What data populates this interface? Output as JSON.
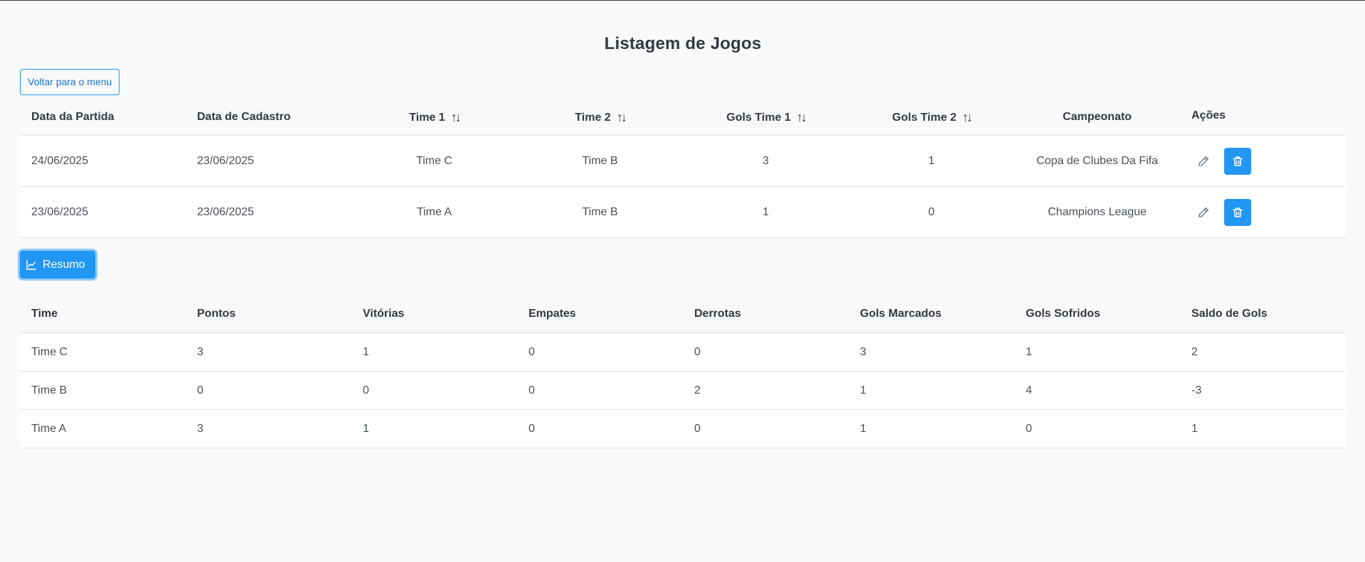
{
  "page_title": "Listagem de Jogos",
  "back_button_label": "Voltar para o menu",
  "games_table": {
    "headers": {
      "data_partida": "Data da Partida",
      "data_cadastro": "Data de Cadastro",
      "time1": "Time 1",
      "time2": "Time 2",
      "gols_time1": "Gols Time 1",
      "gols_time2": "Gols Time 2",
      "campeonato": "Campeonato",
      "acoes": "Ações"
    },
    "sort_icon": "sort-arrows-icon",
    "rows": [
      {
        "data_partida": "24/06/2025",
        "data_cadastro": "23/06/2025",
        "time1": "Time C",
        "time2": "Time B",
        "gols_time1": "3",
        "gols_time2": "1",
        "campeonato": "Copa de Clubes Da Fifa"
      },
      {
        "data_partida": "23/06/2025",
        "data_cadastro": "23/06/2025",
        "time1": "Time A",
        "time2": "Time B",
        "gols_time1": "1",
        "gols_time2": "0",
        "campeonato": "Champions League"
      }
    ],
    "row_actions": {
      "edit_icon": "pencil-icon",
      "delete_icon": "trash-icon"
    }
  },
  "resumo_button_label": "Resumo",
  "resumo_icon": "chart-line-icon",
  "summary_table": {
    "headers": {
      "time": "Time",
      "pontos": "Pontos",
      "vitorias": "Vitórias",
      "empates": "Empates",
      "derrotas": "Derrotas",
      "gols_marcados": "Gols Marcados",
      "gols_sofridos": "Gols Sofridos",
      "saldo": "Saldo de Gols"
    },
    "rows": [
      {
        "time": "Time C",
        "pontos": "3",
        "vitorias": "1",
        "empates": "0",
        "derrotas": "0",
        "gols_marcados": "3",
        "gols_sofridos": "1",
        "saldo": "2"
      },
      {
        "time": "Time B",
        "pontos": "0",
        "vitorias": "0",
        "empates": "0",
        "derrotas": "2",
        "gols_marcados": "1",
        "gols_sofridos": "4",
        "saldo": "-3"
      },
      {
        "time": "Time A",
        "pontos": "3",
        "vitorias": "1",
        "empates": "0",
        "derrotas": "0",
        "gols_marcados": "1",
        "gols_sofridos": "0",
        "saldo": "1"
      }
    ]
  },
  "colors": {
    "primary": "#2196f3",
    "background": "#f8f9fa",
    "text": "#495057",
    "heading": "#343a40"
  }
}
